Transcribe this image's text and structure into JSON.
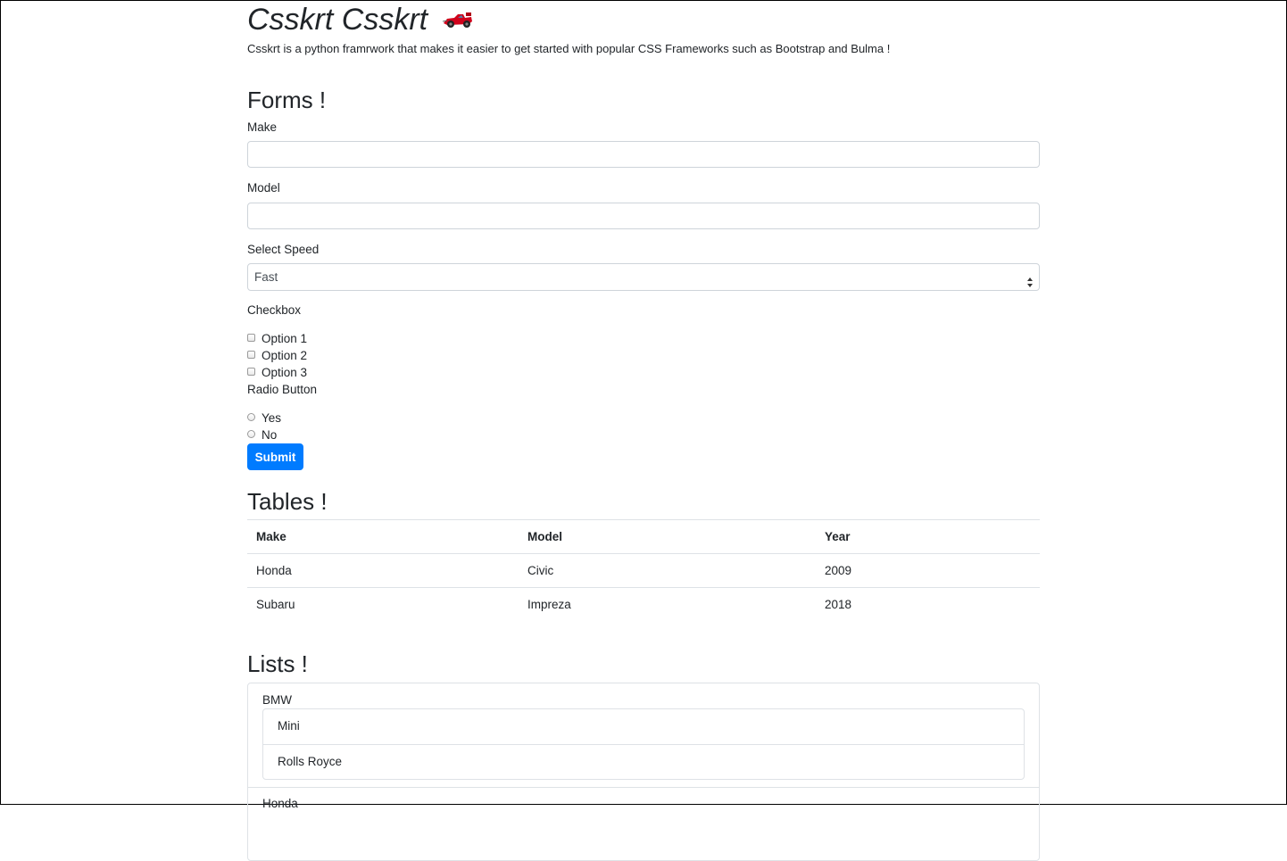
{
  "header": {
    "title": "Csskrt Csskrt",
    "subtitle": "Csskrt is a python framrwork that makes it easier to get started with popular CSS Frameworks such as Bootstrap and Bulma !"
  },
  "forms": {
    "heading": "Forms !",
    "make_label": "Make",
    "make_value": "",
    "model_label": "Model",
    "model_value": "",
    "speed_label": "Select Speed",
    "speed_selected": "Fast",
    "checkbox_label": "Checkbox",
    "checkbox_options": [
      "Option 1",
      "Option 2",
      "Option 3"
    ],
    "radio_label": "Radio Button",
    "radio_options": [
      "Yes",
      "No"
    ],
    "submit_label": "Submit"
  },
  "tables": {
    "heading": "Tables !",
    "columns": [
      "Make",
      "Model",
      "Year"
    ],
    "rows": [
      [
        "Honda",
        "Civic",
        "2009"
      ],
      [
        "Subaru",
        "Impreza",
        "2018"
      ]
    ]
  },
  "lists": {
    "heading": "Lists !",
    "groups": [
      {
        "label": "BMW",
        "items": [
          "Mini",
          "Rolls Royce"
        ]
      },
      {
        "label": "Honda"
      }
    ]
  },
  "icons": {
    "title_icon": "race-car-icon"
  },
  "colors": {
    "accent": "#007bff",
    "text": "#212529",
    "border": "#dee2e6",
    "race_car": "#d0021b"
  }
}
